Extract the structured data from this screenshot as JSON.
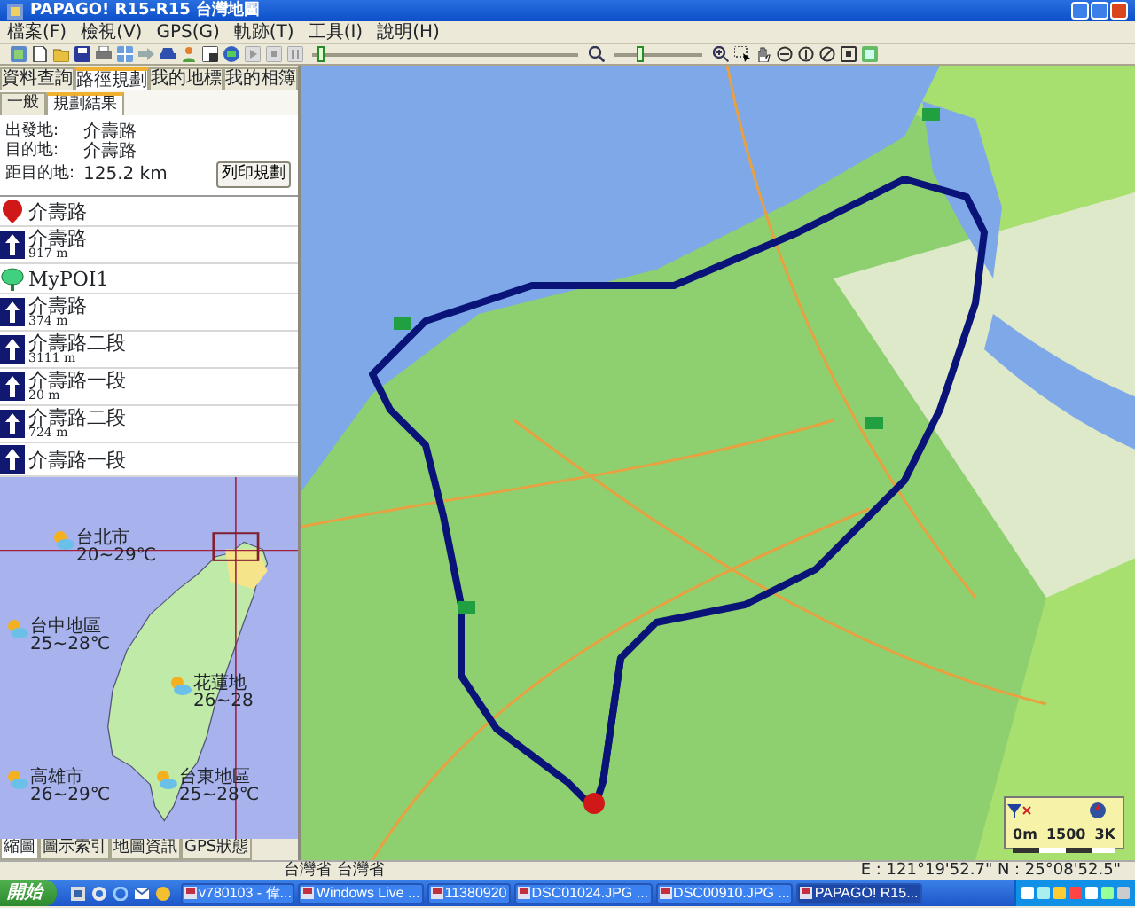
{
  "window": {
    "title": "PAPAGO! R15-R15 台灣地圖"
  },
  "menu": [
    "檔案(F)",
    "檢視(V)",
    "GPS(G)",
    "軌跡(T)",
    "工具(I)",
    "說明(H)"
  ],
  "toolbar": {
    "sliders": [
      {
        "level": 0.02
      },
      {
        "level": 0.3
      }
    ]
  },
  "left_panel": {
    "tabs": [
      {
        "label": "資料查詢",
        "selected": false
      },
      {
        "label": "路徑規劃",
        "selected": true
      },
      {
        "label": "我的地標",
        "selected": false
      },
      {
        "label": "我的相簿",
        "selected": false
      }
    ],
    "subtabs": [
      {
        "label": "一般",
        "selected": false
      },
      {
        "label": "規劃結果",
        "selected": true
      }
    ],
    "route_info": [
      {
        "label": "出發地:",
        "value": "介壽路"
      },
      {
        "label": "目的地:",
        "value": "介壽路"
      },
      {
        "label": "距目的地:",
        "value": "125.2 km"
      }
    ],
    "print_button": "列印規劃",
    "route_steps": [
      {
        "kind": "start",
        "name": "介壽路"
      },
      {
        "kind": "straight",
        "name": "介壽路",
        "distance": "917 m"
      },
      {
        "kind": "poi",
        "name": "MyPOI1"
      },
      {
        "kind": "straight",
        "name": "介壽路",
        "distance": "374 m"
      },
      {
        "kind": "straight",
        "name": "介壽路二段",
        "distance": "3111 m"
      },
      {
        "kind": "straight",
        "name": "介壽路一段",
        "distance": "20 m"
      },
      {
        "kind": "straight",
        "name": "介壽路二段",
        "distance": "724 m"
      },
      {
        "kind": "straight",
        "name": "介壽路一段"
      }
    ]
  },
  "overview_map": {
    "weather": [
      {
        "city": "台北市",
        "temp": "20~29℃"
      },
      {
        "city": "台中地區",
        "temp": "25~28℃"
      },
      {
        "city": "花蓮地",
        "temp": "26~28"
      },
      {
        "city": "高雄市",
        "temp": "26~29℃"
      },
      {
        "city": "台東地區",
        "temp": "25~28℃"
      }
    ]
  },
  "bottom_tabs": [
    {
      "label": "縮圖",
      "selected": true
    },
    {
      "label": "圖示索引",
      "selected": false
    },
    {
      "label": "地圖資訊",
      "selected": false
    },
    {
      "label": "GPS狀態",
      "selected": false
    }
  ],
  "map": {
    "scale": [
      "0m",
      "1500",
      "3K"
    ]
  },
  "status_bar": {
    "region": "台灣省 台灣省",
    "coordinates": "E : 121°19'52.7\"  N : 25°08'52.5\""
  },
  "taskbar": {
    "start": "開始",
    "tasks": [
      {
        "label": "v780103 - 偉...",
        "selected": false
      },
      {
        "label": "Windows Live ...",
        "selected": false
      },
      {
        "label": "11380920",
        "selected": false
      },
      {
        "label": "DSC01024.JPG ...",
        "selected": false
      },
      {
        "label": "DSC00910.JPG ...",
        "selected": false
      },
      {
        "label": "PAPAGO! R15...",
        "selected": true
      }
    ]
  }
}
